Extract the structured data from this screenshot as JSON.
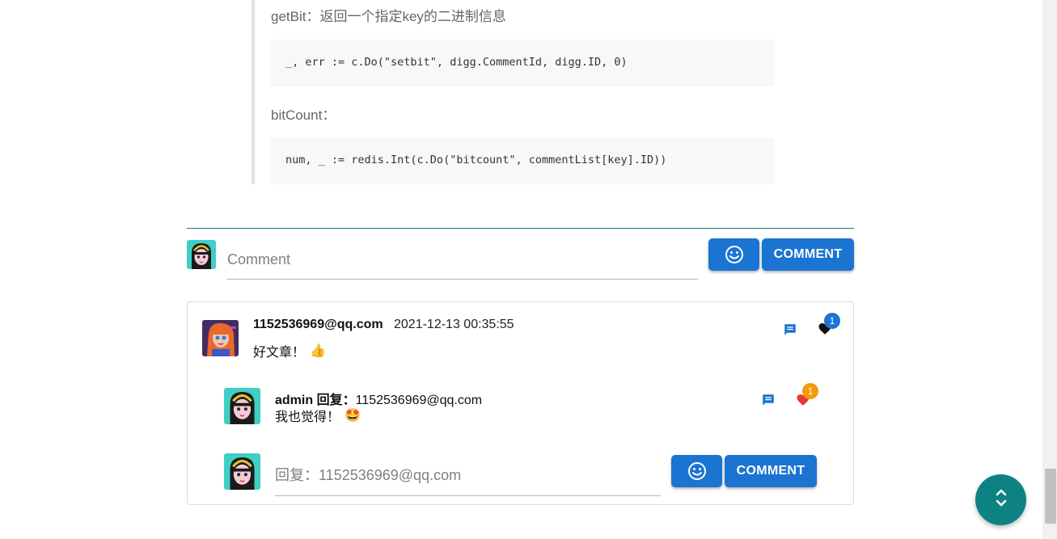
{
  "article": {
    "getbit_text": "getBit：返回一个指定key的二进制信息",
    "getbit_code": "_, err := c.Do(\"setbit\", digg.CommentId, digg.ID, 0)",
    "bitcount_text": "bitCount：",
    "bitcount_code": "num, _ := redis.Int(c.Do(\"bitcount\", commentList[key].ID))"
  },
  "new_comment": {
    "placeholder": "Comment",
    "emoji_icon": "smile-icon",
    "submit_label": "COMMENT"
  },
  "comments": [
    {
      "username": "1152536969@qq.com",
      "timestamp": "2021-12-13 00:35:55",
      "text": "好文章！",
      "emoji": "👍",
      "like_count": "1",
      "reply_icon": "comment-icon",
      "like_icon": "heart-icon",
      "replies": [
        {
          "author": "admin",
          "reply_word": "回复：",
          "reply_to": "1152536969@qq.com",
          "text": "我也觉得！",
          "emoji": "🤩",
          "like_count": "1"
        }
      ],
      "reply_input": {
        "placeholder": "回复：1152536969@qq.com",
        "submit_label": "COMMENT"
      }
    }
  ],
  "colors": {
    "accent": "#1b74d1",
    "teal": "#0e8282",
    "badge_blue": "#1b74d1",
    "badge_orange": "#f59a0c",
    "heart_black": "#111111",
    "heart_red": "#e53935"
  },
  "fab_icon": "unfold-icon"
}
